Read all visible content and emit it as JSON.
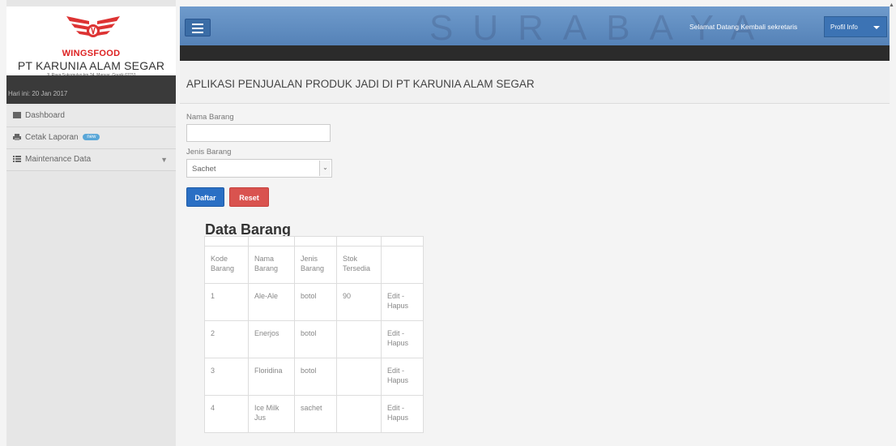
{
  "brand": {
    "sub": "WINGSFOOD",
    "name": "PT KARUNIA ALAM SEGAR",
    "address": "Jl. Raya Sukomulyo km 24, Manyar, Gresik 61151"
  },
  "date_label": "Hari ini: 20 Jan 2017",
  "sidebar": {
    "items": [
      {
        "label": "Dashboard",
        "icon": "dashboard-icon"
      },
      {
        "label": "Cetak Laporan",
        "icon": "printer-icon",
        "badge": "new"
      },
      {
        "label": "Maintenance Data",
        "icon": "list-icon",
        "chevron": "▼"
      }
    ]
  },
  "topbar": {
    "watermark": "SURABAYA",
    "welcome": "Selamat Datang Kembali sekretaris",
    "profile_label": "Profil Info"
  },
  "page_title": "APLIKASI PENJUALAN PRODUK JADI DI PT KARUNIA ALAM SEGAR",
  "form": {
    "nama_label": "Nama Barang",
    "nama_value": "",
    "jenis_label": "Jenis Barang",
    "jenis_value": "Sachet",
    "submit_label": "Daftar",
    "reset_label": "Reset"
  },
  "table": {
    "title": "Data Barang",
    "headers": [
      "Kode Barang",
      "Nama Barang",
      "Jenis Barang",
      "Stok Tersedia",
      ""
    ],
    "rows": [
      {
        "kode": "1",
        "nama": "Ale-Ale",
        "jenis": "botol",
        "stok": "90",
        "aksi": "Edit - Hapus"
      },
      {
        "kode": "2",
        "nama": "Enerjos",
        "jenis": "botol",
        "stok": "",
        "aksi": "Edit - Hapus"
      },
      {
        "kode": "3",
        "nama": "Floridina",
        "jenis": "botol",
        "stok": "",
        "aksi": "Edit - Hapus"
      },
      {
        "kode": "4",
        "nama": "Ice Milk Jus",
        "jenis": "sachet",
        "stok": "",
        "aksi": "Edit - Hapus"
      }
    ]
  },
  "colors": {
    "accent": "#5582b7",
    "primary_button": "#2a6fc4",
    "danger_button": "#d9534f",
    "brand_red": "#dd2222"
  }
}
